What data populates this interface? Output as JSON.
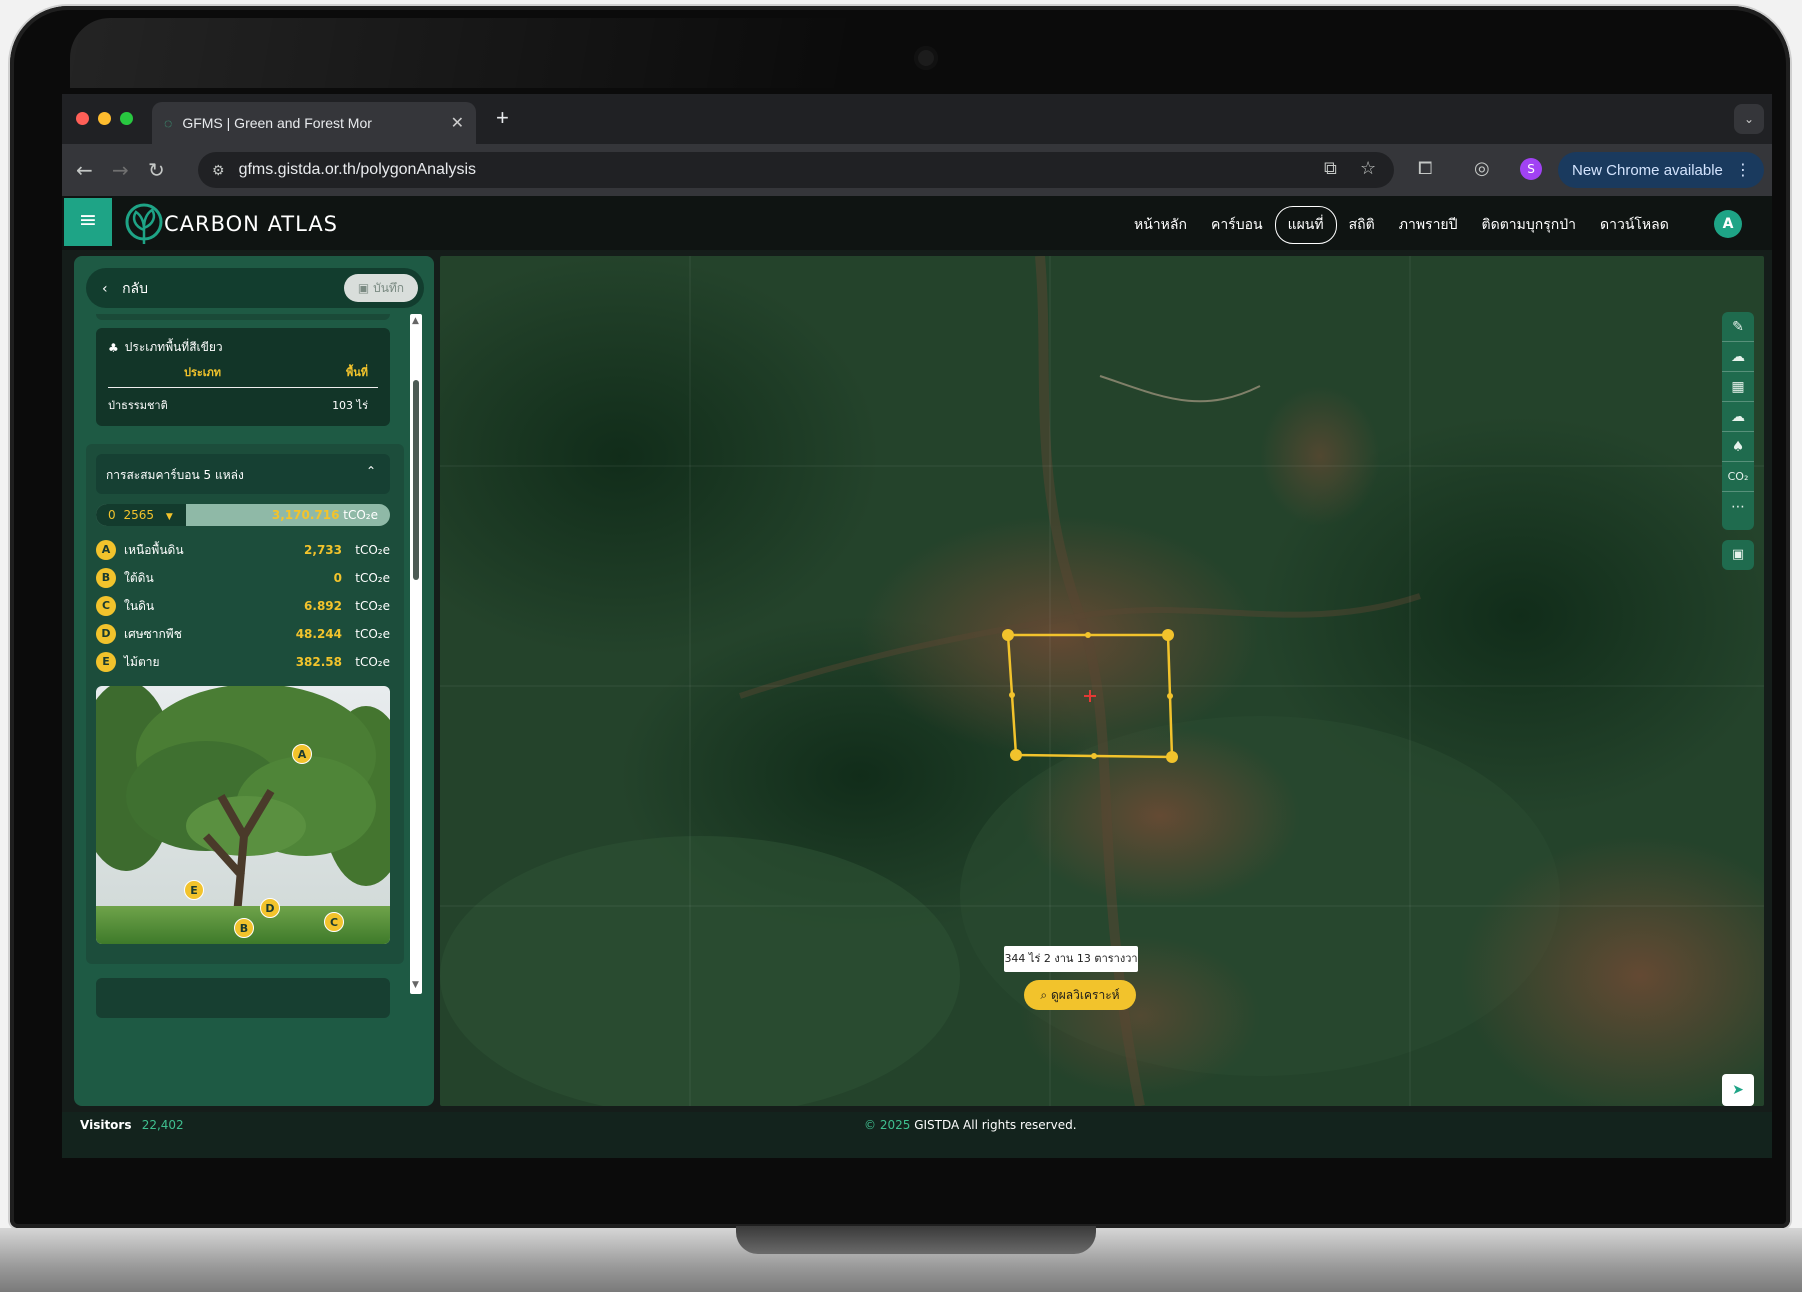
{
  "browser": {
    "tab_title": "GFMS | Green and Forest Mor",
    "url": "gfms.gistda.or.th/polygonAnalysis",
    "update_button": "New Chrome available",
    "profile_initial": "S",
    "colors": {
      "close": "#ff5f57",
      "minimize": "#febc2e",
      "maximize": "#28c840"
    }
  },
  "header": {
    "logo_text": "CARBON ATLAS",
    "nav": [
      "หน้าหลัก",
      "คาร์บอน",
      "แผนที่",
      "สถิติ",
      "ภาพรายปี",
      "ติดตามบุกรุกป่า",
      "ดาวน์โหลด"
    ],
    "active_nav": "แผนที่",
    "user_initial": "A"
  },
  "panel": {
    "back_label": "กลับ",
    "save_label": "บันทึก",
    "green_area": {
      "title": "ประเภทพื้นที่สีเขียว",
      "col_type": "ประเภท",
      "col_area": "พื้นที่",
      "rows": [
        {
          "type": "ป่าธรรมชาติ",
          "area": "103 ไร่"
        }
      ]
    },
    "carbon": {
      "title": "การสะสมคาร์บอน 5 แหล่ง",
      "year": "2565",
      "year_prefix": "0",
      "total": "3,170.716",
      "unit": "tCO₂e",
      "pools": [
        {
          "badge": "A",
          "label": "เหนือพื้นดิน",
          "value": "2,733"
        },
        {
          "badge": "B",
          "label": "ใต้ดิน",
          "value": "0"
        },
        {
          "badge": "C",
          "label": "ในดิน",
          "value": "6.892"
        },
        {
          "badge": "D",
          "label": "เศษซากพืช",
          "value": "48.244"
        },
        {
          "badge": "E",
          "label": "ไม้ตาย",
          "value": "382.58"
        }
      ]
    }
  },
  "map": {
    "area_label": "344 ไร่ 2 งาน 13 ตารางวา",
    "analyze_button": "ดูผลวิเคราะห์",
    "tools": [
      "draw-icon",
      "cloud-icon",
      "building-icon",
      "cloud-icon",
      "tree-icon",
      "co2-icon",
      "more-icon"
    ],
    "co2_label": "CO₂",
    "polygon_color": "#f2c32c"
  },
  "footer": {
    "visitors_label": "Visitors",
    "visitors_count": "22,402",
    "copyright_symbol_year": "© 2025",
    "copyright_text": "GISTDA All rights reserved."
  }
}
